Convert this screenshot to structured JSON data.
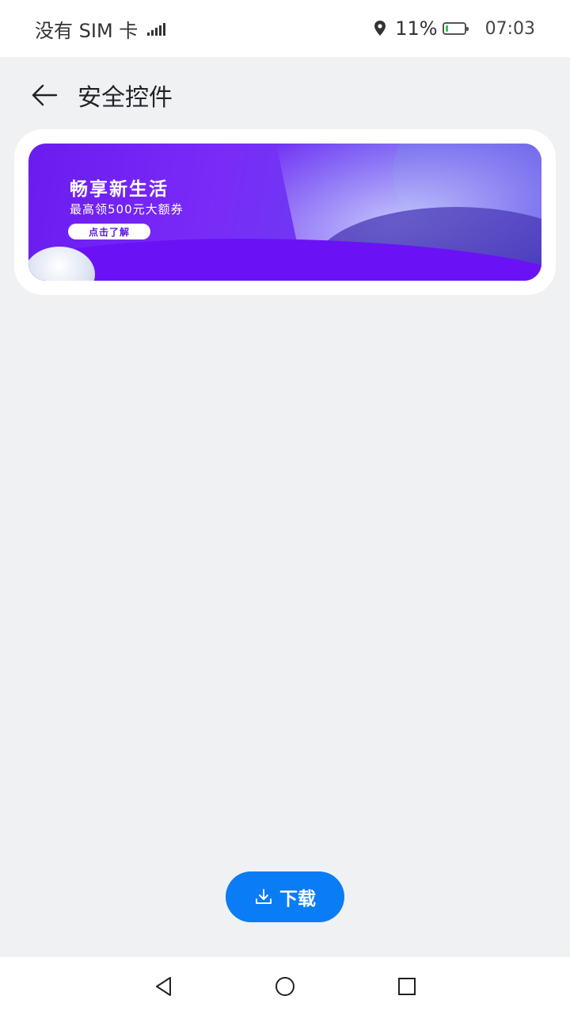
{
  "status_bar": {
    "carrier": "没有 SIM 卡",
    "battery_percent": "11%",
    "battery_level": 0.11,
    "time": "07:03",
    "icons": [
      "signal-icon",
      "location-icon",
      "battery-icon"
    ]
  },
  "header": {
    "title": "安全控件",
    "back_icon": "back-arrow-icon"
  },
  "banner": {
    "title": "畅享新生活",
    "subtitle": "最高领500元大额券",
    "button_label": "点击了解"
  },
  "download": {
    "label": "下载",
    "icon": "download-icon",
    "color": "#0a7cf5"
  },
  "nav_bar": {
    "icons": [
      "back-triangle-icon",
      "home-circle-icon",
      "recents-square-icon"
    ]
  }
}
